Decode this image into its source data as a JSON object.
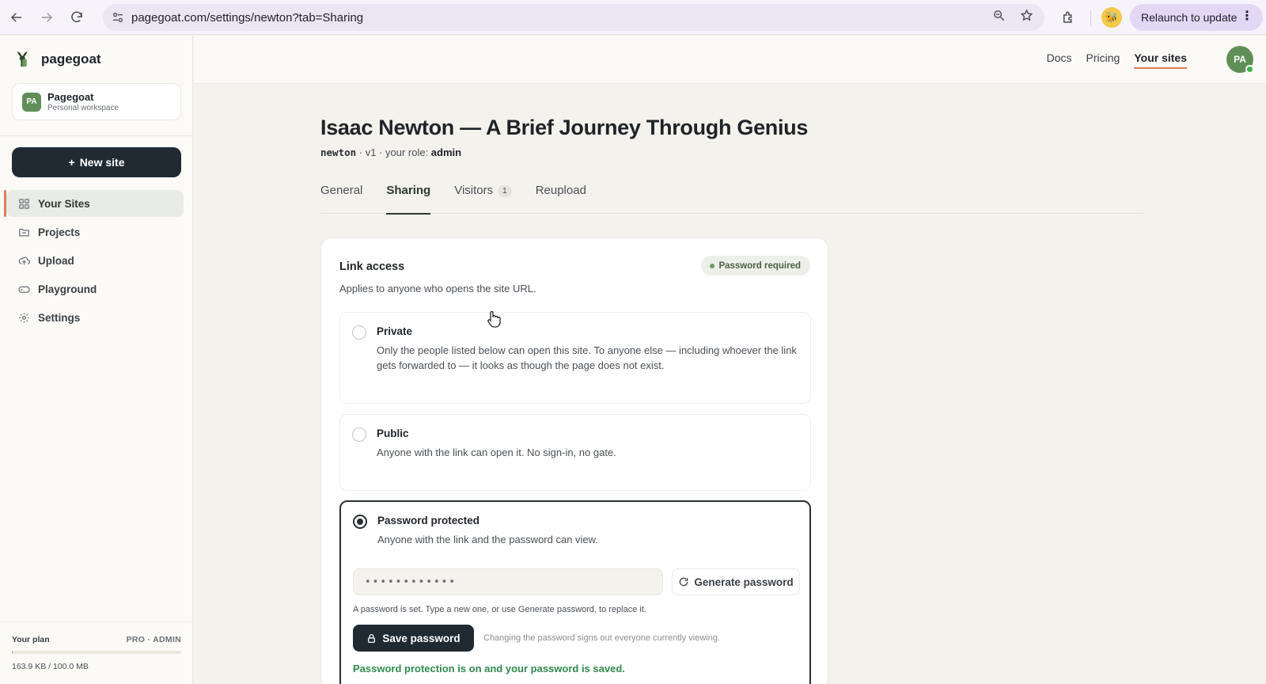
{
  "browser": {
    "url": "pagegoat.com/settings/newton?tab=Sharing",
    "relaunch_label": "Relaunch to update"
  },
  "sidebar": {
    "brand": "pagegoat",
    "workspace": {
      "initials": "PA",
      "name": "Pagegoat",
      "type": "Personal workspace"
    },
    "new_site_label": "New site",
    "items": [
      {
        "label": "Your Sites",
        "icon": "grid-icon",
        "active": true
      },
      {
        "label": "Projects",
        "icon": "folder-icon"
      },
      {
        "label": "Upload",
        "icon": "cloud-upload-icon"
      },
      {
        "label": "Playground",
        "icon": "gamepad-icon"
      },
      {
        "label": "Settings",
        "icon": "gear-icon"
      }
    ],
    "plan": {
      "label": "Your plan",
      "tier": "PRO · ADMIN",
      "usage": "163.9 KB / 100.0 MB",
      "usage_fraction": 0.0016
    }
  },
  "topnav": {
    "links": [
      "Docs",
      "Pricing",
      "Your sites"
    ],
    "active": "Your sites",
    "avatar": "PA"
  },
  "page": {
    "title": "Isaac Newton — A Brief Journey Through Genius",
    "slug": "newton",
    "meta_version": " · v1 · your role: ",
    "role": "admin"
  },
  "tabs": [
    {
      "label": "General"
    },
    {
      "label": "Sharing",
      "active": true
    },
    {
      "label": "Visitors",
      "count": "1"
    },
    {
      "label": "Reupload"
    }
  ],
  "link_access": {
    "title": "Link access",
    "badge": "Password required",
    "subtitle": "Applies to anyone who opens the site URL.",
    "options": [
      {
        "title": "Private",
        "desc": "Only the people listed below can open this site. To anyone else — including whoever the link gets forwarded to — it looks as though the page does not exist.",
        "selected": false
      },
      {
        "title": "Public",
        "desc": "Anyone with the link can open it. No sign-in, no gate.",
        "selected": false
      },
      {
        "title": "Password protected",
        "desc": "Anyone with the link and the password can view.",
        "selected": true
      }
    ],
    "password_value": "••••••••••••",
    "generate_label": "Generate password",
    "help": "A password is set. Type a new one, or use Generate password, to replace it.",
    "save_label": "Save password",
    "save_note": "Changing the password signs out everyone currently viewing.",
    "status": "Password protection is on and your password is saved."
  },
  "colors": {
    "accent": "#e07a5f",
    "primary_dark": "#1f2a33",
    "success": "#2f8a4e",
    "brand_green": "#5f8f57"
  }
}
